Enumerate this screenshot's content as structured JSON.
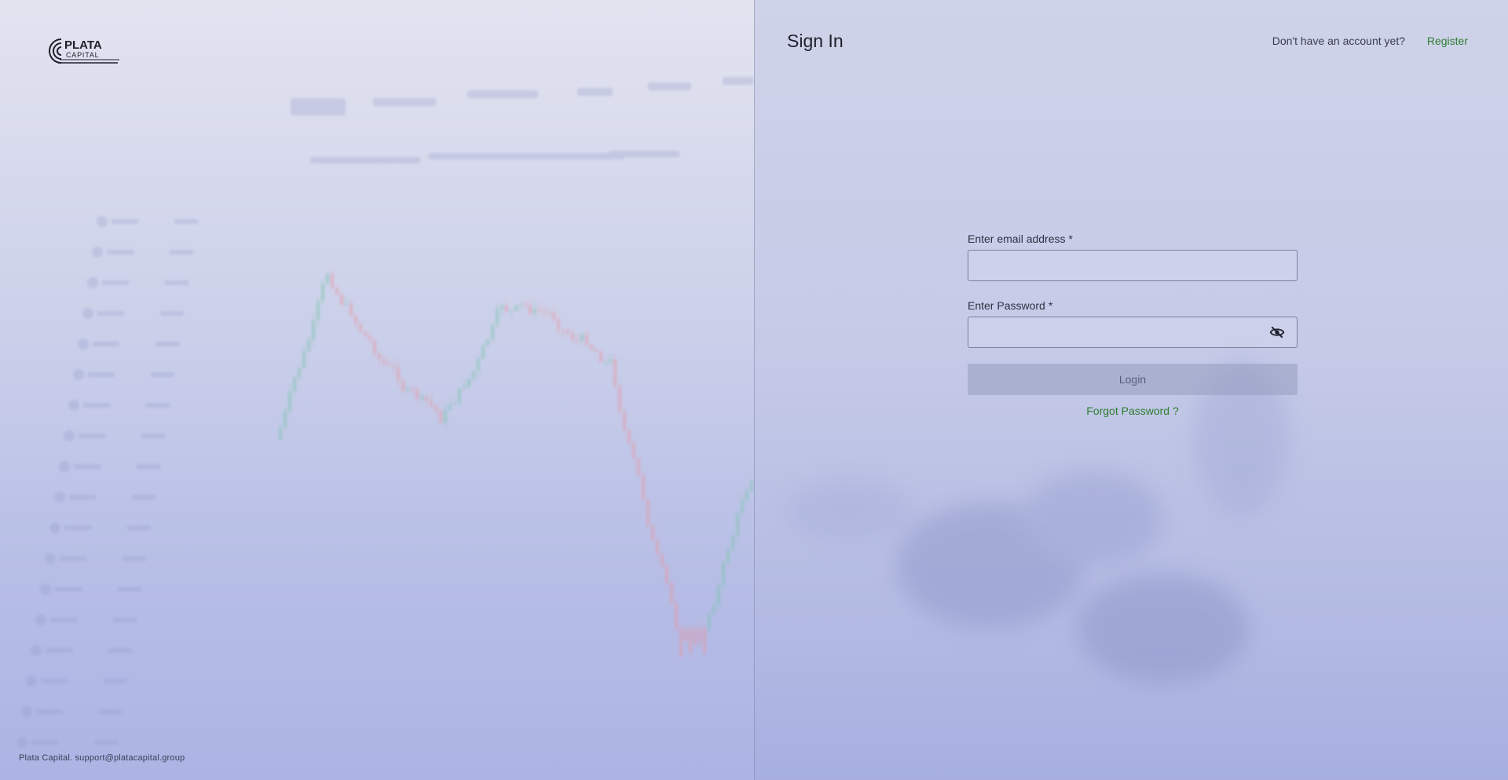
{
  "brand": {
    "logo_top": "PLATA",
    "logo_bottom": "CAPITAL",
    "footer": "Plata Capital. support@platacapital.group"
  },
  "header": {
    "title": "Sign In",
    "account_prompt": "Don't have an account yet?",
    "register_label": "Register"
  },
  "form": {
    "email_label": "Enter email address",
    "email_value": "",
    "password_label": "Enter Password",
    "password_value": "",
    "required_mark": "*",
    "login_label": "Login",
    "forgot_label": "Forgot Password ?",
    "password_toggle_icon": "eye-off-icon"
  },
  "colors": {
    "link_green": "#2e7d32",
    "text_dark": "#1d1f2a"
  }
}
